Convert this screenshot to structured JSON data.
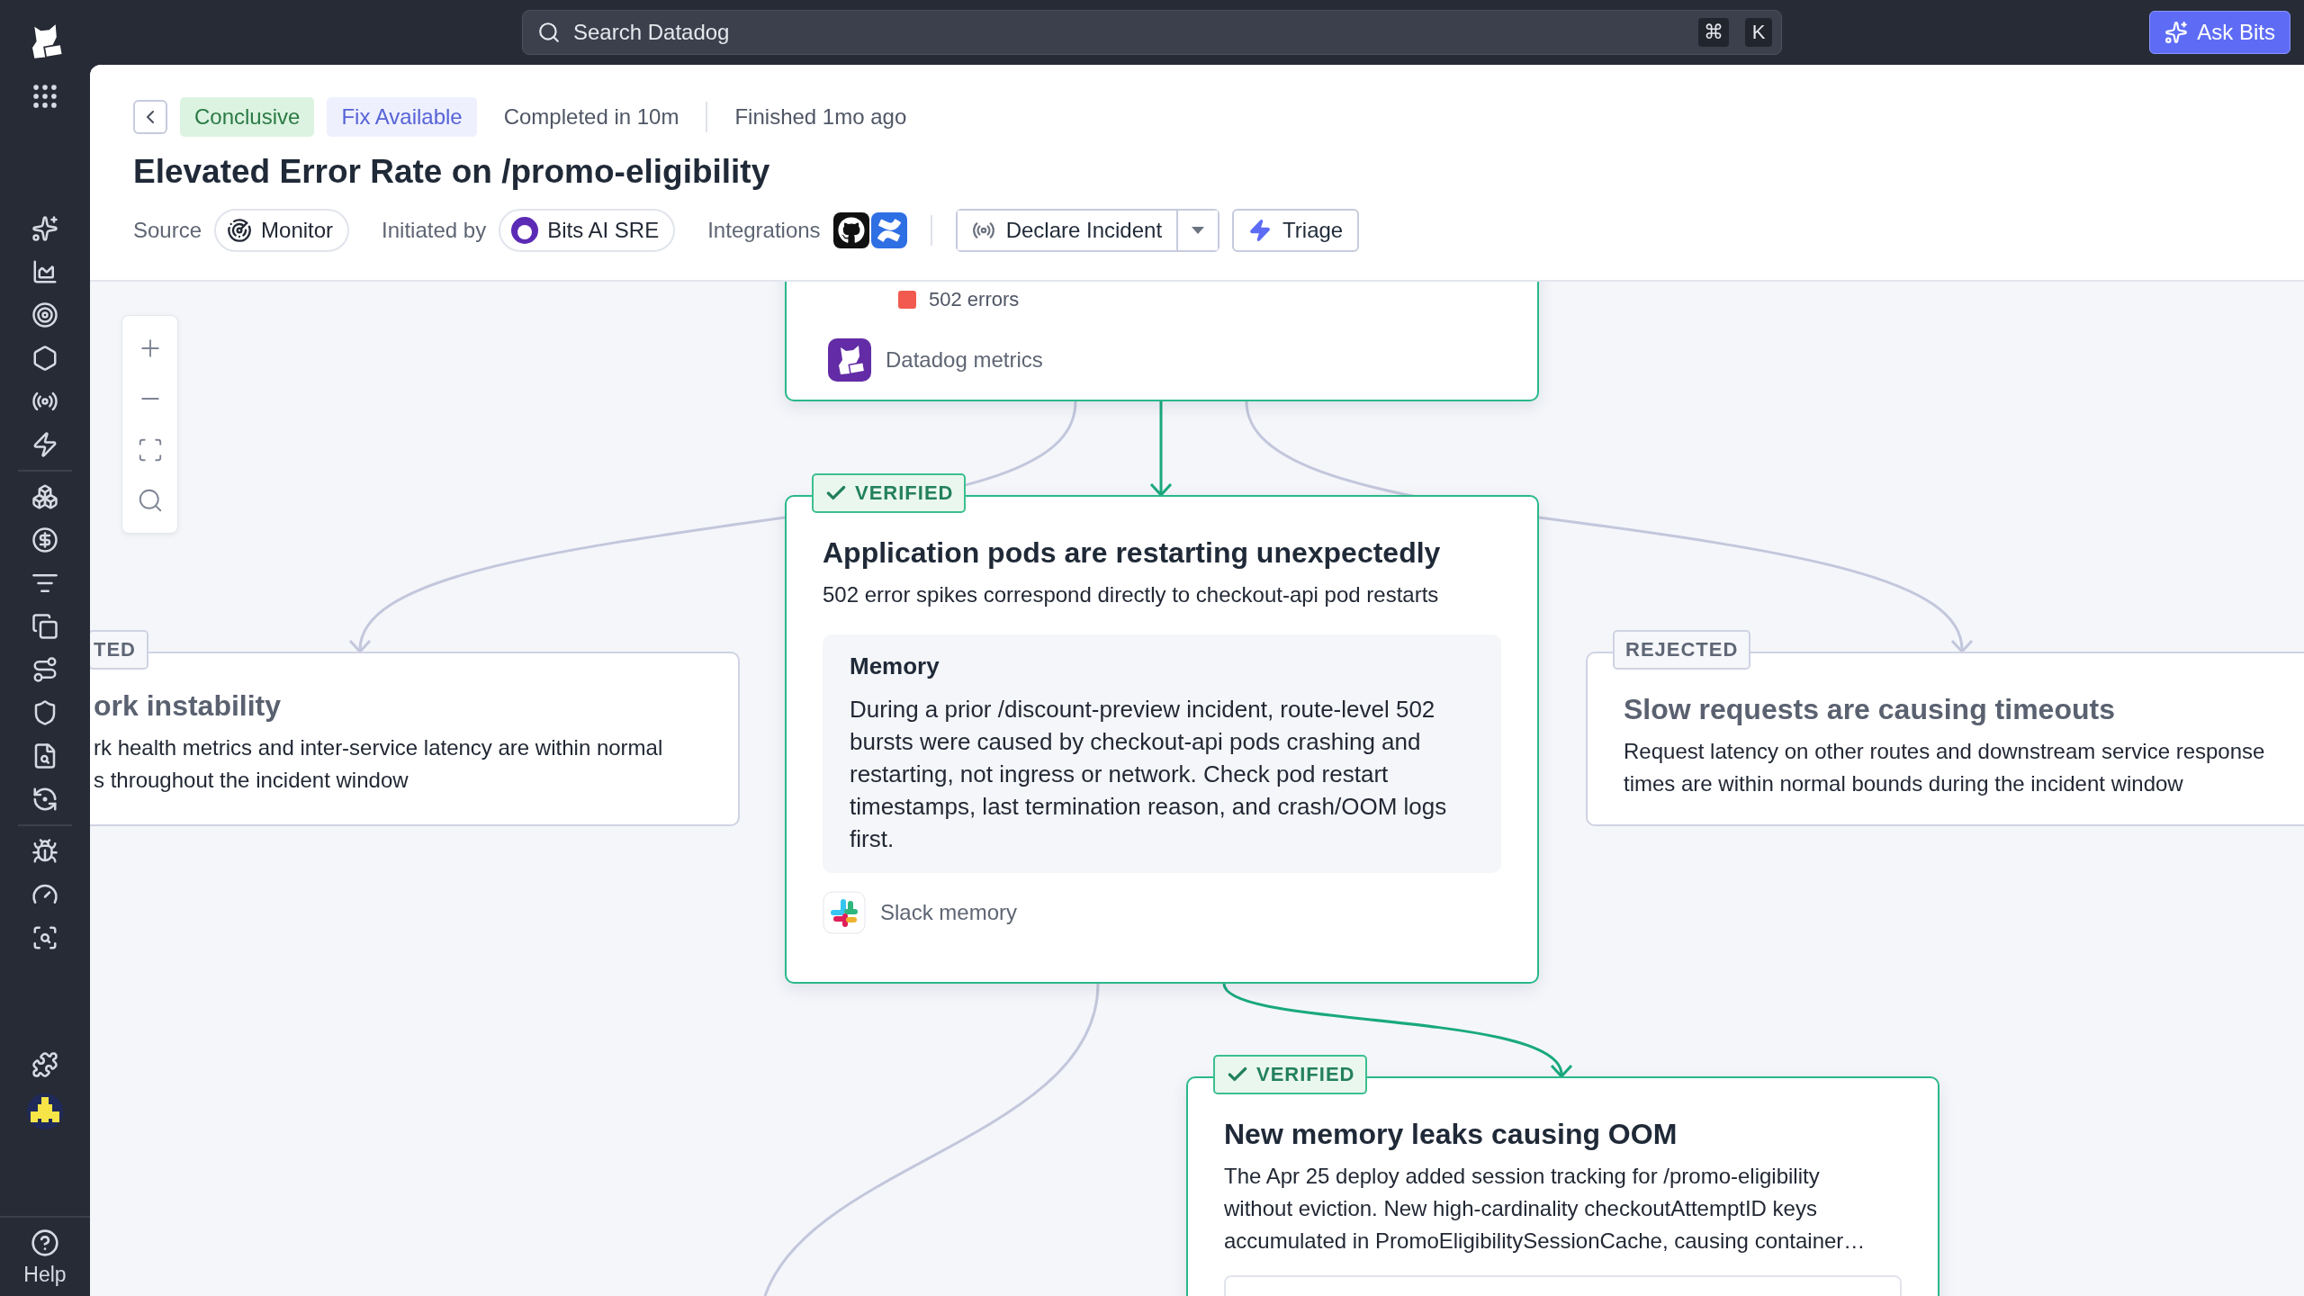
{
  "topbar": {
    "search": {
      "placeholder": "Search Datadog"
    },
    "shortcut_keys": [
      "⌘",
      "K"
    ],
    "ask_button": "Ask Bits"
  },
  "sidebar": {
    "help_label": "Help"
  },
  "header": {
    "tags": [
      {
        "text": "Conclusive",
        "kind": "success"
      },
      {
        "text": "Fix Available",
        "kind": "info"
      }
    ],
    "meta": [
      "Completed in 10m",
      "Finished 1mo ago"
    ],
    "title": "Elevated Error Rate on /promo-eligibility",
    "source": {
      "label": "Source",
      "value": "Monitor"
    },
    "initiated_by": {
      "label": "Initiated by",
      "value": "Bits AI SRE"
    },
    "integrations": {
      "label": "Integrations"
    },
    "declare_button": "Declare Incident",
    "triage_button": "Triage"
  },
  "nodes": [
    {
      "kind": "evidence",
      "legend": [
        {
          "text": "502 errors",
          "color": "#f25a4f"
        }
      ],
      "source": {
        "kind": "datadog",
        "text": "Datadog metrics"
      }
    },
    {
      "kind": "hypothesis",
      "verified": true,
      "badge": "VERIFIED",
      "title": "Application pods are restarting unexpectedly",
      "lines": [
        "502 error spikes correspond directly to checkout-api pod restarts"
      ],
      "memory": {
        "title": "Memory",
        "body": "During a prior /discount-preview incident, route-level 502 bursts were caused by checkout-api pods crashing and restarting, not ingress or network. Check pod restart timestamps, last termination reason, and crash/OOM logs first."
      },
      "source": {
        "kind": "slack",
        "text": "Slack memory"
      }
    },
    {
      "kind": "hypothesis",
      "verified": false,
      "badge": "TED",
      "title": "ork instability",
      "lines": [
        "rk health metrics and inter-service latency are within normal",
        "s throughout the incident window"
      ]
    },
    {
      "kind": "hypothesis",
      "verified": false,
      "badge": "REJECTED",
      "title": "Slow requests are causing timeouts",
      "lines": [
        "Request latency on other routes and downstream service response",
        "times are within normal bounds during the incident window"
      ]
    },
    {
      "kind": "hypothesis",
      "verified": true,
      "badge": "VERIFIED",
      "title": "New memory leaks causing OOM",
      "lines": [
        "The Apr 25 deploy added session tracking for /promo-eligibility",
        "without eviction. New high-cardinality checkoutAttemptID keys",
        "accumulated in PromoEligibilitySessionCache, causing container…"
      ],
      "code_box": true
    }
  ]
}
